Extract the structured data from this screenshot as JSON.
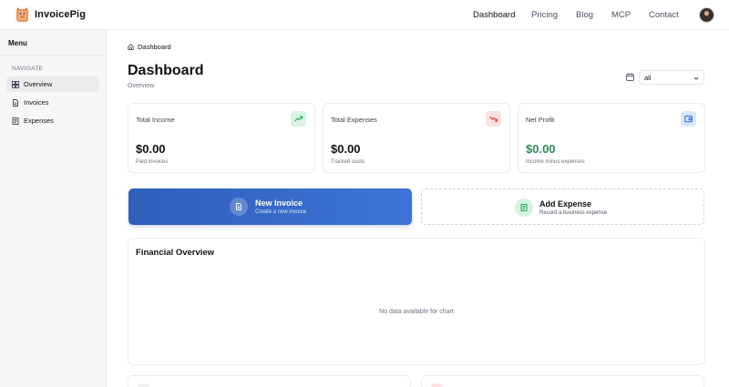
{
  "header": {
    "brand": "InvoicePig",
    "nav": [
      {
        "label": "Dashboard",
        "active": true
      },
      {
        "label": "Pricing",
        "active": false
      },
      {
        "label": "Blog",
        "active": false
      },
      {
        "label": "MCP",
        "active": false
      },
      {
        "label": "Contact",
        "active": false
      }
    ]
  },
  "sidebar": {
    "title": "Menu",
    "group_label": "NAVIGATE",
    "items": [
      {
        "label": "Overview",
        "icon": "grid-icon",
        "active": true
      },
      {
        "label": "Invoices",
        "icon": "file-icon",
        "active": false
      },
      {
        "label": "Expenses",
        "icon": "receipt-icon",
        "active": false
      }
    ]
  },
  "breadcrumb": {
    "label": "Dashboard",
    "icon": "home-icon"
  },
  "page": {
    "title": "Dashboard",
    "subtitle": "Overview"
  },
  "period_filter": {
    "value": "all",
    "icon": "calendar-icon"
  },
  "stats": [
    {
      "label": "Total Income",
      "value": "$0.00",
      "note": "Paid invoices",
      "icon": "trending-up-icon",
      "icon_bg": "#d9f4e3",
      "icon_color": "#16a34a",
      "value_color": "#111111"
    },
    {
      "label": "Total Expenses",
      "value": "$0.00",
      "note": "Tracked costs",
      "icon": "trending-down-icon",
      "icon_bg": "#fde0e0",
      "icon_color": "#dc2626",
      "value_color": "#111111"
    },
    {
      "label": "Net Profit",
      "value": "$0.00",
      "note": "Income minus expenses",
      "icon": "wallet-icon",
      "icon_bg": "#dbe7fb",
      "icon_color": "#2563eb",
      "value_color": "#2e8b57"
    }
  ],
  "actions": [
    {
      "title": "New Invoice",
      "subtitle": "Create a new invoice",
      "icon": "document-icon"
    },
    {
      "title": "Add Expense",
      "subtitle": "Record a business expense",
      "icon": "receipt-icon"
    }
  ],
  "financial_overview": {
    "title": "Financial Overview",
    "empty_text": "No data available for chart"
  },
  "colors": {
    "primary_gradient_start": "#2f5fb9",
    "primary_gradient_end": "#3e74d6",
    "profit_green": "#2e8b57"
  }
}
